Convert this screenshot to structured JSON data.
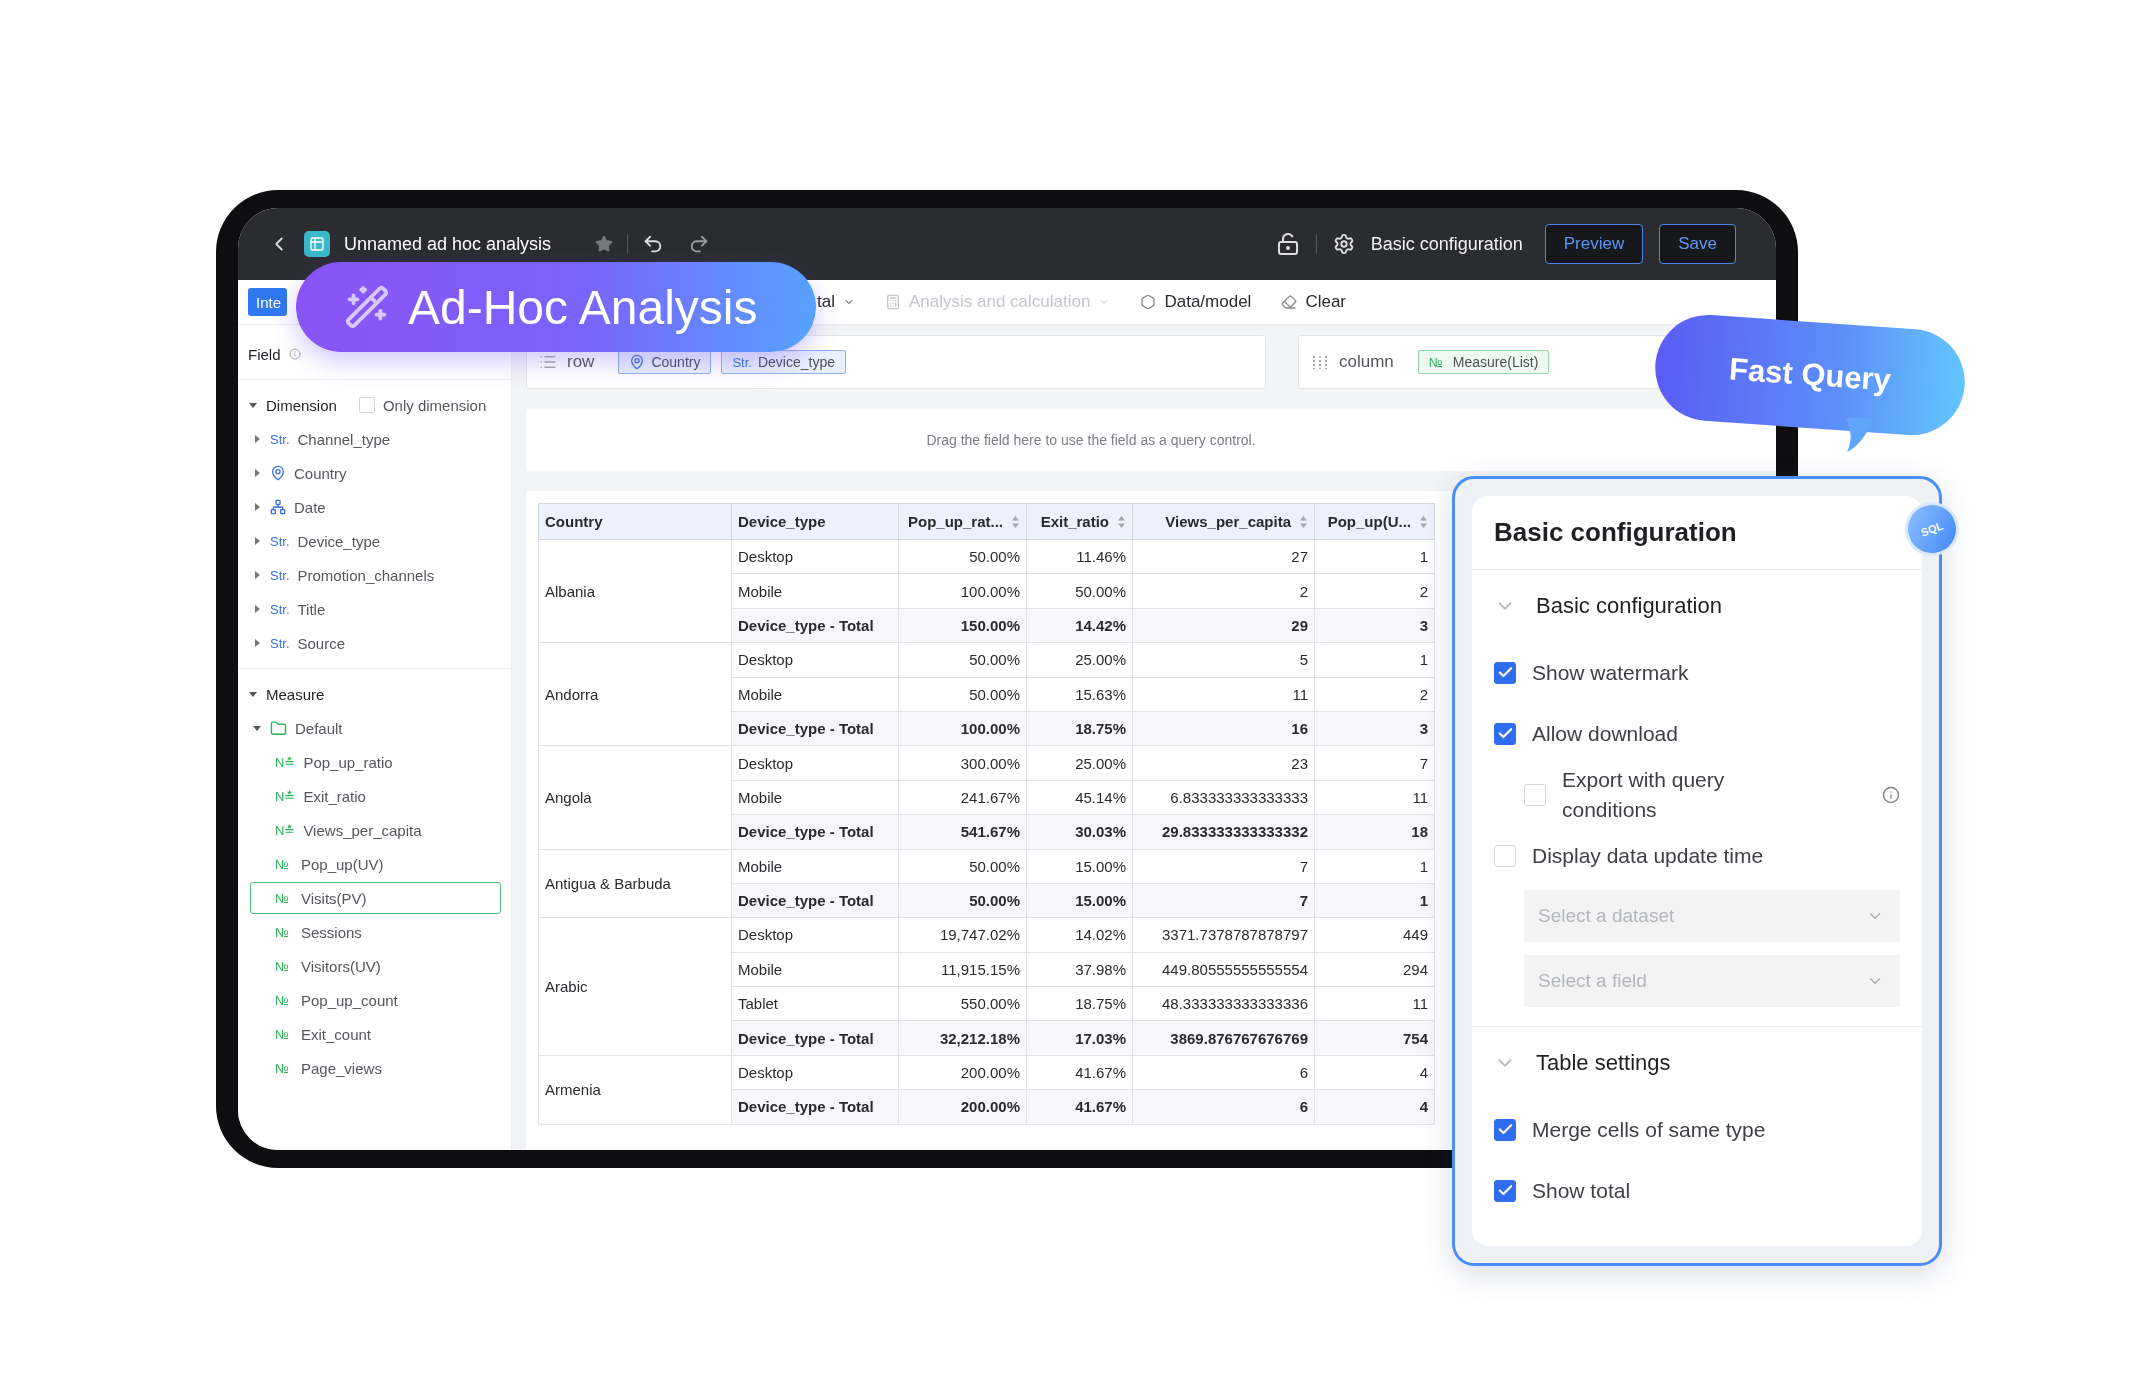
{
  "topbar": {
    "title": "Unnamed ad hoc analysis",
    "config_label": "Basic configuration",
    "buttons": [
      "Preview",
      "Save"
    ]
  },
  "toolbar": {
    "items": [
      {
        "kind": "primary",
        "label": "Inte",
        "disabled": false
      },
      {
        "kind": "menu",
        "label": "tal",
        "disabled": false
      },
      {
        "kind": "menu",
        "label": "Analysis and calculation",
        "disabled": true
      },
      {
        "kind": "model",
        "label": "Data/model",
        "disabled": false
      },
      {
        "kind": "clear",
        "label": "Clear",
        "disabled": false
      }
    ]
  },
  "sidebar": {
    "title": "Field",
    "dimension": {
      "label": "Dimension",
      "expanded": true,
      "filter_label": "Only dimension",
      "filter_checked": false,
      "items": [
        {
          "kind": "str",
          "type_label": "Str.",
          "label": "Channel_type"
        },
        {
          "kind": "geo",
          "label": "Country"
        },
        {
          "kind": "date",
          "label": "Date"
        },
        {
          "kind": "str",
          "type_label": "Str.",
          "label": "Device_type"
        },
        {
          "kind": "str",
          "type_label": "Str.",
          "label": "Promotion_channels"
        },
        {
          "kind": "str",
          "type_label": "Str.",
          "label": "Title"
        },
        {
          "kind": "str",
          "type_label": "Str.",
          "label": "Source"
        }
      ]
    },
    "measure": {
      "label": "Measure",
      "expanded": true,
      "folders": [
        {
          "label": "Default",
          "expanded": true,
          "children": [
            {
              "type_label": "N≛",
              "label": "Pop_up_ratio",
              "selected": false
            },
            {
              "type_label": "N≛",
              "label": "Exit_ratio",
              "selected": false
            },
            {
              "type_label": "N≛",
              "label": "Views_per_capita",
              "selected": false
            },
            {
              "type_label": "№",
              "label": "Pop_up(UV)",
              "selected": false
            },
            {
              "type_label": "№",
              "label": "Visits(PV)",
              "selected": true
            },
            {
              "type_label": "№",
              "label": "Sessions",
              "selected": false
            },
            {
              "type_label": "№",
              "label": "Visitors(UV)",
              "selected": false
            },
            {
              "type_label": "№",
              "label": "Pop_up_count",
              "selected": false
            },
            {
              "type_label": "№",
              "label": "Exit_count",
              "selected": false
            },
            {
              "type_label": "№",
              "label": "Page_views",
              "selected": false
            }
          ]
        }
      ]
    }
  },
  "shelves": {
    "row": {
      "label": "row",
      "chips": [
        {
          "kind": "geo",
          "label": "Country"
        },
        {
          "kind": "str",
          "type_label": "Str.",
          "label": "Device_type"
        }
      ]
    },
    "column": {
      "label": "column",
      "chips": [
        {
          "kind": "num",
          "type_label": "№",
          "label": "Measure(List)"
        }
      ]
    }
  },
  "query_area": {
    "hint": "Drag the field here to use the field as a query control."
  },
  "table": {
    "columns": [
      {
        "label": "Country",
        "sortable": false
      },
      {
        "label": "Device_type",
        "sortable": false
      },
      {
        "label": "Pop_up_rat...",
        "sortable": true
      },
      {
        "label": "Exit_ratio",
        "sortable": true
      },
      {
        "label": "Views_per_capita",
        "sortable": true
      },
      {
        "label": "Pop_up(U...",
        "sortable": true
      }
    ],
    "groups": [
      {
        "country": "Albania",
        "rows": [
          {
            "device": "Desktop",
            "total": false,
            "values": [
              "50.00%",
              "11.46%",
              "27",
              "1"
            ]
          },
          {
            "device": "Mobile",
            "total": false,
            "values": [
              "100.00%",
              "50.00%",
              "2",
              "2"
            ]
          },
          {
            "device": "Device_type - Total",
            "total": true,
            "values": [
              "150.00%",
              "14.42%",
              "29",
              "3"
            ]
          }
        ]
      },
      {
        "country": "Andorra",
        "rows": [
          {
            "device": "Desktop",
            "total": false,
            "values": [
              "50.00%",
              "25.00%",
              "5",
              "1"
            ]
          },
          {
            "device": "Mobile",
            "total": false,
            "values": [
              "50.00%",
              "15.63%",
              "11",
              "2"
            ]
          },
          {
            "device": "Device_type - Total",
            "total": true,
            "values": [
              "100.00%",
              "18.75%",
              "16",
              "3"
            ]
          }
        ]
      },
      {
        "country": "Angola",
        "rows": [
          {
            "device": "Desktop",
            "total": false,
            "values": [
              "300.00%",
              "25.00%",
              "23",
              "7"
            ]
          },
          {
            "device": "Mobile",
            "total": false,
            "values": [
              "241.67%",
              "45.14%",
              "6.833333333333333",
              "11"
            ]
          },
          {
            "device": "Device_type - Total",
            "total": true,
            "values": [
              "541.67%",
              "30.03%",
              "29.833333333333332",
              "18"
            ]
          }
        ]
      },
      {
        "country": "Antigua & Barbuda",
        "rows": [
          {
            "device": "Mobile",
            "total": false,
            "values": [
              "50.00%",
              "15.00%",
              "7",
              "1"
            ]
          },
          {
            "device": "Device_type - Total",
            "total": true,
            "values": [
              "50.00%",
              "15.00%",
              "7",
              "1"
            ]
          }
        ]
      },
      {
        "country": "Arabic",
        "rows": [
          {
            "device": "Desktop",
            "total": false,
            "values": [
              "19,747.02%",
              "14.02%",
              "3371.7378787878797",
              "449"
            ]
          },
          {
            "device": "Mobile",
            "total": false,
            "values": [
              "11,915.15%",
              "37.98%",
              "449.80555555555554",
              "294"
            ]
          },
          {
            "device": "Tablet",
            "total": false,
            "values": [
              "550.00%",
              "18.75%",
              "48.333333333333336",
              "11"
            ]
          },
          {
            "device": "Device_type - Total",
            "total": true,
            "values": [
              "32,212.18%",
              "17.03%",
              "3869.876767676769",
              "754"
            ]
          }
        ]
      },
      {
        "country": "Armenia",
        "rows": [
          {
            "device": "Desktop",
            "total": false,
            "values": [
              "200.00%",
              "41.67%",
              "6",
              "4"
            ]
          },
          {
            "device": "Device_type - Total",
            "total": true,
            "values": [
              "200.00%",
              "41.67%",
              "6",
              "4"
            ]
          }
        ]
      }
    ]
  },
  "config_panel": {
    "title": "Basic configuration",
    "badge": "SQL",
    "sections": [
      {
        "title": "Basic configuration",
        "expanded": true,
        "items": [
          {
            "kind": "checkbox",
            "label": "Show watermark",
            "checked": true,
            "info": false
          },
          {
            "kind": "checkbox",
            "label": "Allow download",
            "checked": true,
            "info": false,
            "children": [
              {
                "kind": "checkbox",
                "label": "Export with query conditions",
                "checked": false,
                "info": true
              }
            ]
          },
          {
            "kind": "checkbox",
            "label": "Display data update time",
            "checked": false,
            "info": false,
            "children": [
              {
                "kind": "select",
                "placeholder": "Select a dataset"
              },
              {
                "kind": "select",
                "placeholder": "Select a field"
              }
            ]
          }
        ]
      },
      {
        "title": "Table settings",
        "expanded": true,
        "items": [
          {
            "kind": "checkbox",
            "label": "Merge cells of same type",
            "checked": true,
            "info": false
          },
          {
            "kind": "checkbox",
            "label": "Show total",
            "checked": true,
            "info": false
          }
        ]
      }
    ]
  },
  "badges": [
    {
      "kind": "pill",
      "label": "Ad-Hoc Analysis"
    },
    {
      "kind": "bubble",
      "label": "Fast Query"
    }
  ]
}
